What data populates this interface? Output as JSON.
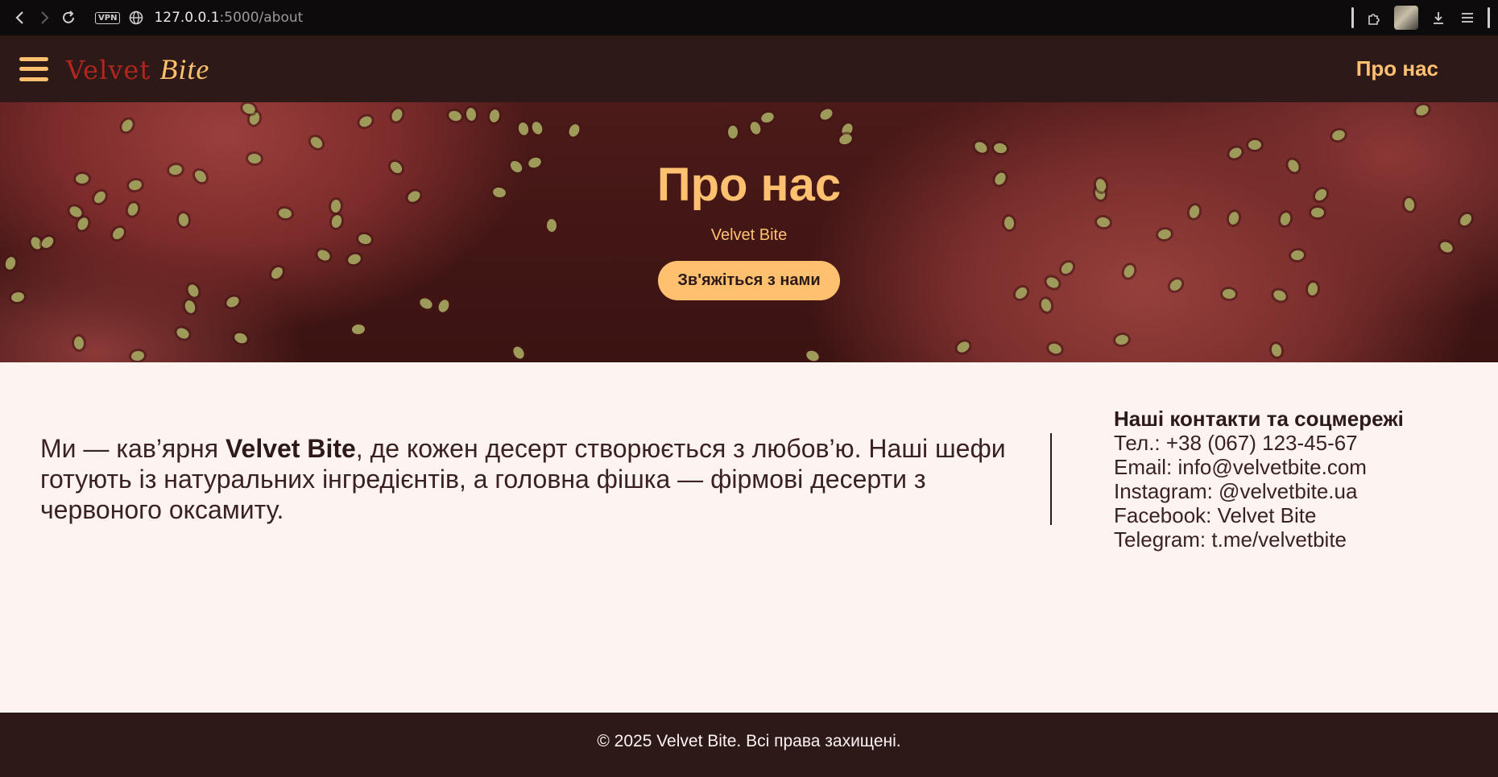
{
  "browser": {
    "url_host": "127.0.0.1",
    "url_path": ":5000/about",
    "vpn_label": "VPN"
  },
  "header": {
    "logo_main": "Velvet ",
    "logo_script": "Bite",
    "nav_link": "Про нас",
    "accent_color": "#ffc170",
    "background_color": "#2d1a18"
  },
  "hero": {
    "title": "Про нас",
    "subtitle": "Velvet Bite",
    "cta_label": "Зв'яжіться з нами"
  },
  "about": {
    "text_before": "Ми — кав’ярня ",
    "brand": "Velvet Bite",
    "text_after": ", де кожен десерт створюється з любов’ю. Наші шефи готують із натуральних інгредієнтів, а головна фішка — фірмові десерти з червоного оксамиту."
  },
  "contacts": {
    "title": "Наші контакти та соцмережі",
    "items": [
      "Тел.: +38 (067) 123-45-67",
      "Email: info@velvetbite.com",
      "Instagram: @velvetbite.ua",
      "Facebook: Velvet Bite",
      "Telegram: t.me/velvetbite"
    ]
  },
  "footer": {
    "copyright": "© 2025 Velvet Bite. Всі права захищені."
  }
}
